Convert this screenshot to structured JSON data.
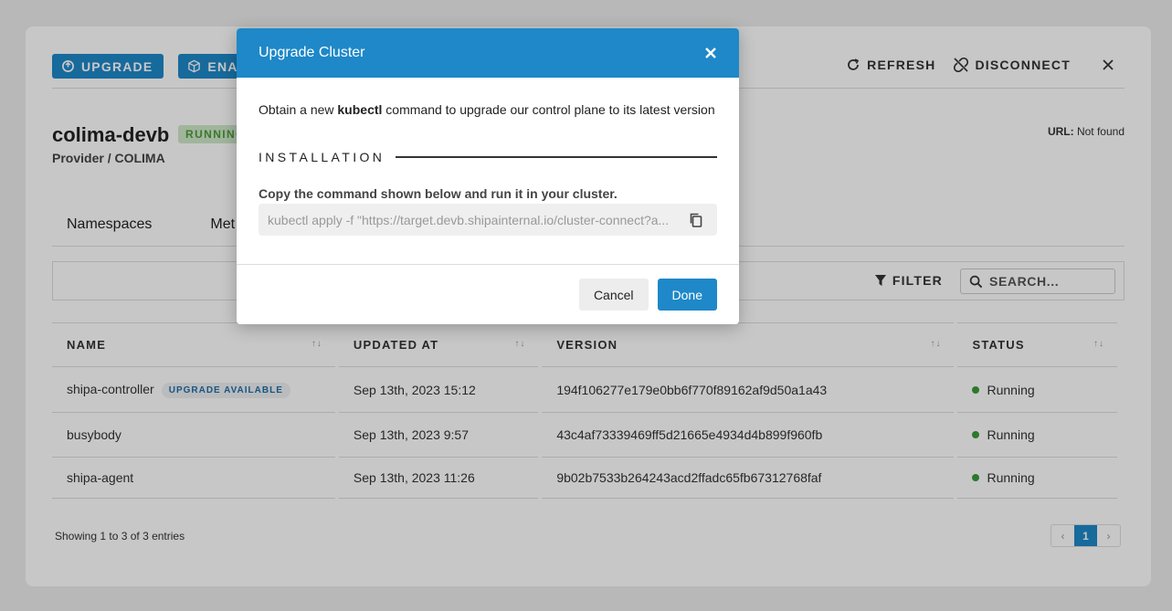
{
  "toolbar": {
    "upgrade_label": "UPGRADE",
    "enable_label": "ENAB",
    "refresh_label": "REFRESH",
    "disconnect_label": "DISCONNECT"
  },
  "cluster": {
    "name": "colima-devb",
    "status": "RUNNING",
    "provider": "Provider / COLIMA",
    "url_label": "URL:",
    "url_value": "Not found"
  },
  "tabs": [
    {
      "label": "Namespaces"
    },
    {
      "label": "Met"
    }
  ],
  "filter": {
    "filter_label": "FILTER",
    "search_placeholder": "SEARCH..."
  },
  "table": {
    "columns": [
      "NAME",
      "UPDATED AT",
      "VERSION",
      "STATUS"
    ],
    "sort_glyph": "↑↓",
    "rows": [
      {
        "name": "shipa-controller",
        "badge": "UPGRADE AVAILABLE",
        "updated_at": "Sep 13th, 2023 15:12",
        "version": "194f106277e179e0bb6f770f89162af9d50a1a43",
        "status": "Running"
      },
      {
        "name": "busybody",
        "badge": "",
        "updated_at": "Sep 13th, 2023 9:57",
        "version": "43c4af73339469ff5d21665e4934d4b899f960fb",
        "status": "Running"
      },
      {
        "name": "shipa-agent",
        "badge": "",
        "updated_at": "Sep 13th, 2023 11:26",
        "version": "9b02b7533b264243acd2ffadc65fb67312768faf",
        "status": "Running"
      }
    ]
  },
  "footer": {
    "showing": "Showing 1 to 3 of 3 entries",
    "page_prev": "‹",
    "page_current": "1",
    "page_next": "›"
  },
  "modal": {
    "title": "Upgrade Cluster",
    "desc_before": "Obtain a new ",
    "desc_bold": "kubectl",
    "desc_after": " command to upgrade our control plane to its latest version",
    "install_heading": "INSTALLATION",
    "copy_label": "Copy the command shown below and run it in your cluster.",
    "command": "kubectl apply -f \"https://target.devb.shipainternal.io/cluster-connect?a...",
    "cancel_label": "Cancel",
    "done_label": "Done"
  },
  "colors": {
    "primary": "#1e88c8",
    "running_green": "#3a9a3a",
    "badge_running_bg": "#cfe8c9"
  }
}
